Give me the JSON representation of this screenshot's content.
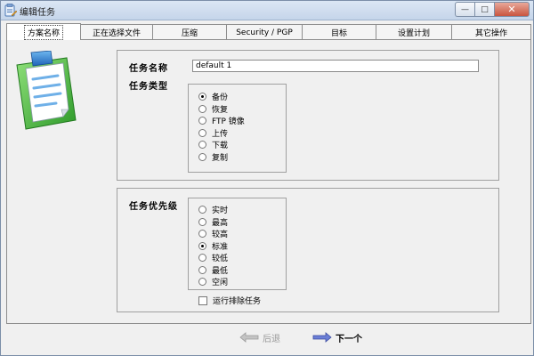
{
  "window": {
    "title": "编辑任务",
    "controls": [
      {
        "name": "minimize",
        "glyph": "—"
      },
      {
        "name": "maximize",
        "glyph": "□"
      },
      {
        "name": "close",
        "glyph": "✕"
      }
    ]
  },
  "tabs": [
    {
      "label": "方案名称",
      "active": true
    },
    {
      "label": "正在选择文件",
      "active": false
    },
    {
      "label": "压缩",
      "active": false
    },
    {
      "label": "Security / PGP",
      "active": false
    },
    {
      "label": "目标",
      "active": false
    },
    {
      "label": "设置计划",
      "active": false
    },
    {
      "label": "其它操作",
      "active": false
    }
  ],
  "task": {
    "name_label": "任务名称",
    "name_value": "default 1",
    "type_label": "任务类型",
    "types": [
      {
        "label": "备份",
        "selected": true
      },
      {
        "label": "恢复",
        "selected": false
      },
      {
        "label": "FTP 镜像",
        "selected": false
      },
      {
        "label": "上传",
        "selected": false
      },
      {
        "label": "下载",
        "selected": false
      },
      {
        "label": "复制",
        "selected": false
      }
    ]
  },
  "priority": {
    "label": "任务优先级",
    "options": [
      {
        "label": "实时",
        "selected": false
      },
      {
        "label": "最高",
        "selected": false
      },
      {
        "label": "较高",
        "selected": false
      },
      {
        "label": "标准",
        "selected": true
      },
      {
        "label": "较低",
        "selected": false
      },
      {
        "label": "最低",
        "selected": false
      },
      {
        "label": "空闲",
        "selected": false
      }
    ],
    "exclusive_label": "运行排除任务",
    "exclusive_checked": false
  },
  "nav": {
    "back_label": "后退",
    "next_label": "下一个"
  },
  "icons": {
    "app": "task-edit-icon",
    "illustration": "clipboard-icon",
    "back": "arrow-left-icon",
    "next": "arrow-right-icon"
  }
}
